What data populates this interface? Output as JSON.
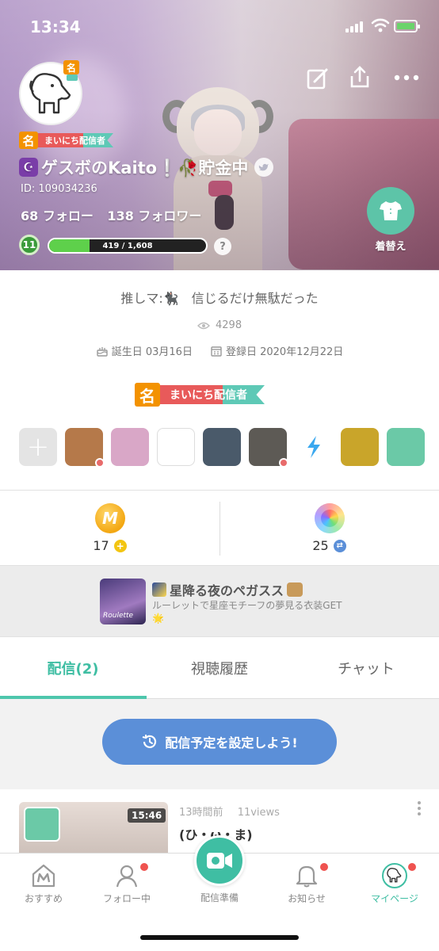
{
  "status_bar": {
    "time": "13:34"
  },
  "profile": {
    "ribbon_mark": "名",
    "ribbon_label": "まいにち配信者",
    "name": "ゲスボのKaito❕🥀貯金中",
    "moon_glyph": "☪",
    "id": "ID: 109034236",
    "following": "68 フォロー",
    "followers": "138 フォロワー",
    "level": "11",
    "xp_text": "419 / 1,608",
    "xp_fraction": 0.26,
    "help": "?",
    "dress_label": "着替え",
    "bio": "推しマ:🐈‍⬛　信じるだけ無駄だった",
    "views": "4298",
    "birthday": "誕生日 03月16日",
    "registered": "登録日 2020年12月22日"
  },
  "icons": {
    "edit": "edit-icon",
    "share": "share-icon",
    "more": "more-icon",
    "twitter": "twitter-icon",
    "eye": "eye-icon",
    "cake": "cake-icon",
    "calendar": "calendar-icon"
  },
  "games": [
    {
      "name": "add-game",
      "color": "#e4e4e4"
    },
    {
      "name": "game-pubg",
      "color": "#b5794a",
      "badge": true
    },
    {
      "name": "game-anime",
      "color": "#d9a7c7"
    },
    {
      "name": "game-horror",
      "color": "#ffffff"
    },
    {
      "name": "game-callofduty",
      "color": "#4a5a6a"
    },
    {
      "name": "game-identity",
      "color": "#5d5a55",
      "badge": true
    },
    {
      "name": "game-bolt",
      "color": "#ffffff"
    },
    {
      "name": "game-soldier",
      "color": "#c9a52a"
    },
    {
      "name": "game-chat",
      "color": "#6bc9a7"
    }
  ],
  "currency": {
    "coins": "17",
    "gems": "25",
    "coin_color": "#f3a712",
    "gem_color": "#7a7ad8"
  },
  "event": {
    "title": "星降る夜のペガスス",
    "description": "ルーレットで星座モチーフの夢見る衣装GET🌟",
    "thumb_text": "Roulette"
  },
  "tabs": [
    {
      "label": "配信(2)",
      "active": true
    },
    {
      "label": "視聴履歴",
      "active": false
    },
    {
      "label": "チャット",
      "active": false
    }
  ],
  "schedule_button": "配信予定を設定しよう!",
  "stream": {
    "duration": "15:46",
    "time_ago": "13時間前",
    "views": "11views",
    "title": "(ひ・ω・ま)"
  },
  "nav": [
    {
      "label": "おすすめ",
      "dot": false
    },
    {
      "label": "フォロー中",
      "dot": true
    },
    {
      "label": "配信準備",
      "dot": false
    },
    {
      "label": "お知らせ",
      "dot": true
    },
    {
      "label": "マイページ",
      "dot": true
    }
  ],
  "colors": {
    "accent": "#3fbea3",
    "button": "#5b8fd8",
    "notification": "#ef5350"
  }
}
